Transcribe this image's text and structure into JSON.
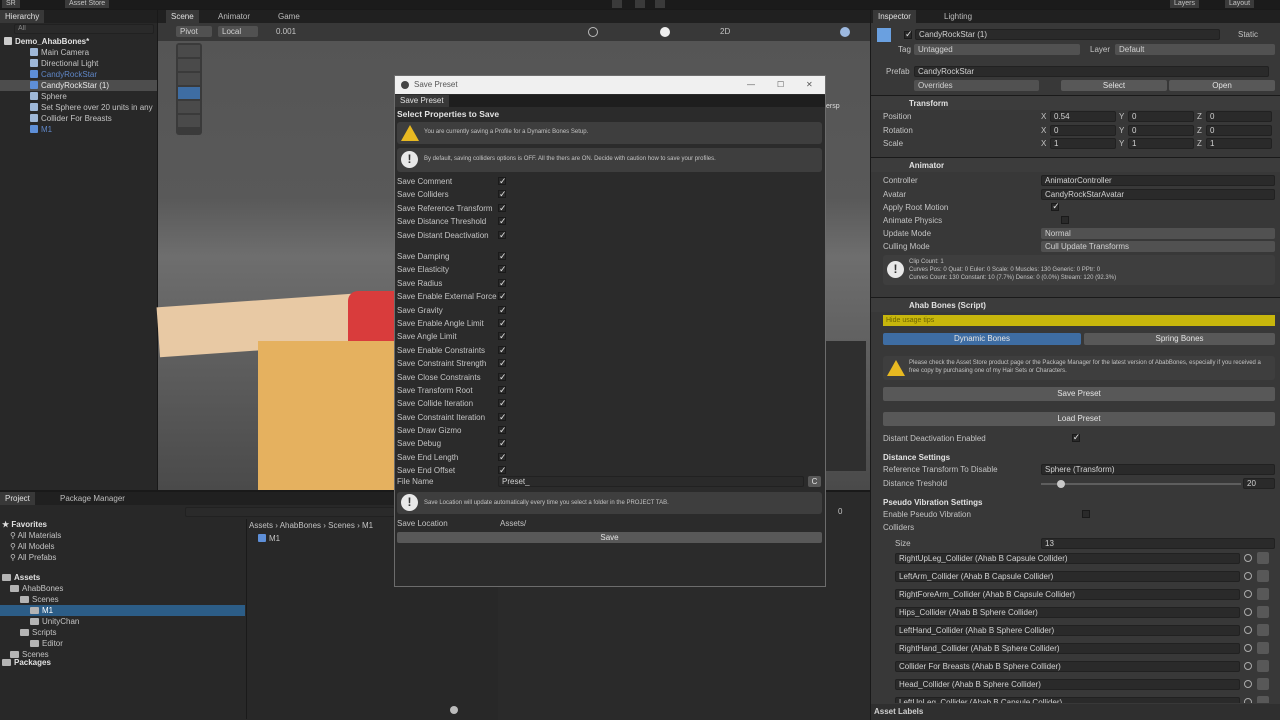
{
  "topbar": {
    "account": "SR",
    "asset_store": "Asset Store",
    "layers": "Layers",
    "layout": "Layout"
  },
  "hierarchy": {
    "tab": "Hierarchy",
    "search_placeholder": "All",
    "scene": "Demo_AhabBones*",
    "items": [
      "Main Camera",
      "Directional Light",
      "CandyRockStar",
      "CandyRockStar (1)",
      "Sphere",
      "Set Sphere over 20 units in any",
      "Collider For Breasts",
      "M1"
    ]
  },
  "scene_view": {
    "tabs": [
      "Scene",
      "Animator",
      "Game"
    ],
    "pivot": "Pivot",
    "local": "Local",
    "snap": "0.001",
    "two_d": "2D",
    "persp": "ersp"
  },
  "project": {
    "tabs": [
      "Project",
      "Package Manager"
    ],
    "favorites": "Favorites",
    "favorite_items": [
      "All Materials",
      "All Models",
      "All Prefabs"
    ],
    "assets": "Assets",
    "tree": [
      "AhabBones",
      "Scenes",
      "M1",
      "UnityChan",
      "Scripts",
      "Editor",
      "Scenes"
    ],
    "packages": "Packages",
    "breadcrumb": [
      "Assets",
      "AhabBones",
      "Scenes",
      "M1"
    ],
    "content_item": "M1",
    "count": "0"
  },
  "dialog": {
    "title": "Save Preset",
    "tab": "Save Preset",
    "heading": "Select Properties to Save",
    "warning": "You are currently saving a Profile for a Dynamic Bones Setup.",
    "info": "By default, saving colliders options is OFF. All the thers are ON. Decide with caution how to save your profiles.",
    "group1": [
      "Save Comment",
      "Save Colliders",
      "Save Reference Transform",
      "Save Distance Threshold",
      "Save Distant Deactivation"
    ],
    "group2": [
      "Save Damping",
      "Save Elasticity",
      "Save Radius",
      "Save Enable External Force",
      "Save Gravity",
      "Save Enable Angle Limit",
      "Save Angle Limit",
      "Save Enable Constraints",
      "Save Constraint Strength",
      "Save Close Constraints",
      "Save Transform Root",
      "Save Collide Iteration",
      "Save Constraint Iteration",
      "Save Draw Gizmo",
      "Save Debug",
      "Save End Length",
      "Save End Offset"
    ],
    "file_name_label": "File Name",
    "file_name_value": "Preset_",
    "clear_button": "C",
    "save_location_info": "Save Location will update automatically every time you select a folder in the PROJECT TAB.",
    "save_location_label": "Save Location",
    "save_location_value": "Assets/",
    "save_button": "Save"
  },
  "inspector": {
    "tabs": [
      "Inspector",
      "Lighting"
    ],
    "object_name": "CandyRockStar (1)",
    "static": "Static",
    "tag_label": "Tag",
    "tag_value": "Untagged",
    "layer_label": "Layer",
    "layer_value": "Default",
    "prefab_label": "Prefab",
    "prefab_value": "CandyRockStar",
    "overrides": "Overrides",
    "select": "Select",
    "open": "Open",
    "transform": {
      "title": "Transform",
      "rows": [
        {
          "label": "Position",
          "x": "0.54",
          "y": "0",
          "z": "0"
        },
        {
          "label": "Rotation",
          "x": "0",
          "y": "0",
          "z": "0"
        },
        {
          "label": "Scale",
          "x": "1",
          "y": "1",
          "z": "1"
        }
      ]
    },
    "animator": {
      "title": "Animator",
      "controller_label": "Controller",
      "controller_value": "AnimatorController",
      "avatar_label": "Avatar",
      "avatar_value": "CandyRockStarAvatar",
      "apply_root_motion": "Apply Root Motion",
      "animate_physics": "Animate Physics",
      "update_mode_label": "Update Mode",
      "update_mode_value": "Normal",
      "culling_mode_label": "Culling Mode",
      "culling_mode_value": "Cull Update Transforms",
      "info_lines": [
        "Clip Count: 1",
        "Curves Pos: 0 Quat: 0 Euler: 0 Scale: 0 Muscles: 130 Generic: 0 PPtr: 0",
        "Curves Count: 130 Constant: 10 (7.7%) Dense: 0 (0.0%) Stream: 120 (92.3%)"
      ]
    },
    "ahab": {
      "title": "Ahab Bones (Script)",
      "tips": "Hide usage tips",
      "tab_dynamic": "Dynamic Bones",
      "tab_spring": "Spring Bones",
      "warning": "Please check the Asset Store product page or the Package Manager for the latest version of AbabBones, especially if you received a free copy by purchasing one of my Hair Sets or Characters.",
      "save_preset": "Save Preset",
      "load_preset": "Load Preset",
      "distant_deactivation": "Distant Deactivation Enabled",
      "distance_settings": "Distance Settings",
      "reference_transform_label": "Reference Transform To Disable",
      "reference_transform_value": "Sphere (Transform)",
      "distance_treshold_label": "Distance Treshold",
      "distance_treshold_value": "20",
      "slider_fraction": 0.1,
      "pseudo_title": "Pseudo Vibration Settings",
      "enable_pseudo": "Enable Pseudo Vibration",
      "colliders": "Colliders",
      "size_label": "Size",
      "size_value": "13",
      "collider_items": [
        "RightUpLeg_Collider (Ahab B Capsule Collider)",
        "LeftArm_Collider (Ahab B Capsule Collider)",
        "RightForeArm_Collider (Ahab B Capsule Collider)",
        "Hips_Collider (Ahab B Sphere Collider)",
        "LeftHand_Collider (Ahab B Sphere Collider)",
        "RightHand_Collider (Ahab B Sphere Collider)",
        "Collider For Breasts (Ahab B Sphere Collider)",
        "Head_Collider (Ahab B Sphere Collider)",
        "LeftUpLeg_Collider (Ahab B Capsule Collider)"
      ]
    },
    "asset_labels": "Asset Labels"
  },
  "colors": {
    "accent_blue": "#3e6da3",
    "warning_yellow": "#e8b921",
    "tips_bar": "#c7b60c"
  }
}
